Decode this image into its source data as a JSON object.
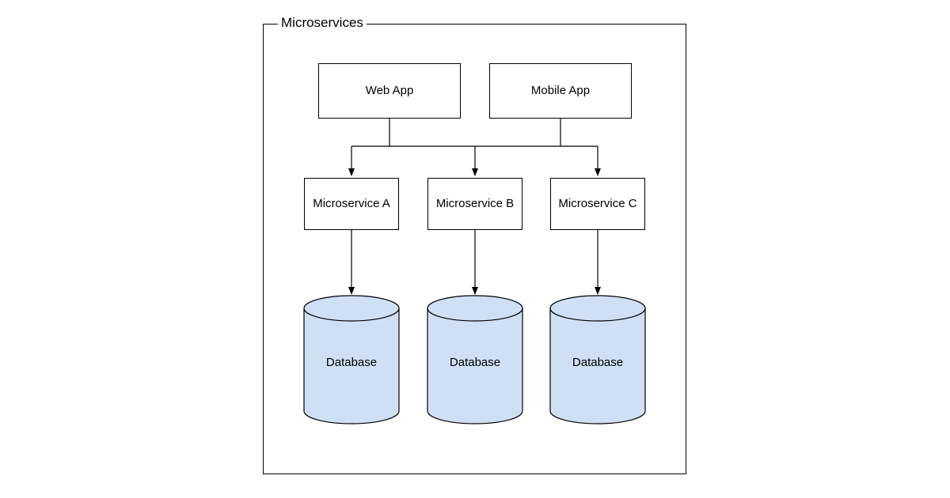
{
  "title": "Microservices",
  "clients": {
    "web": "Web App",
    "mobile": "Mobile App"
  },
  "services": {
    "a": "Microservice A",
    "b": "Microservice B",
    "c": "Microservice C"
  },
  "databases": {
    "a": "Database",
    "b": "Database",
    "c": "Database"
  },
  "colors": {
    "db_fill": "#cfe0f5",
    "db_stroke": "#000000",
    "line": "#000000"
  }
}
